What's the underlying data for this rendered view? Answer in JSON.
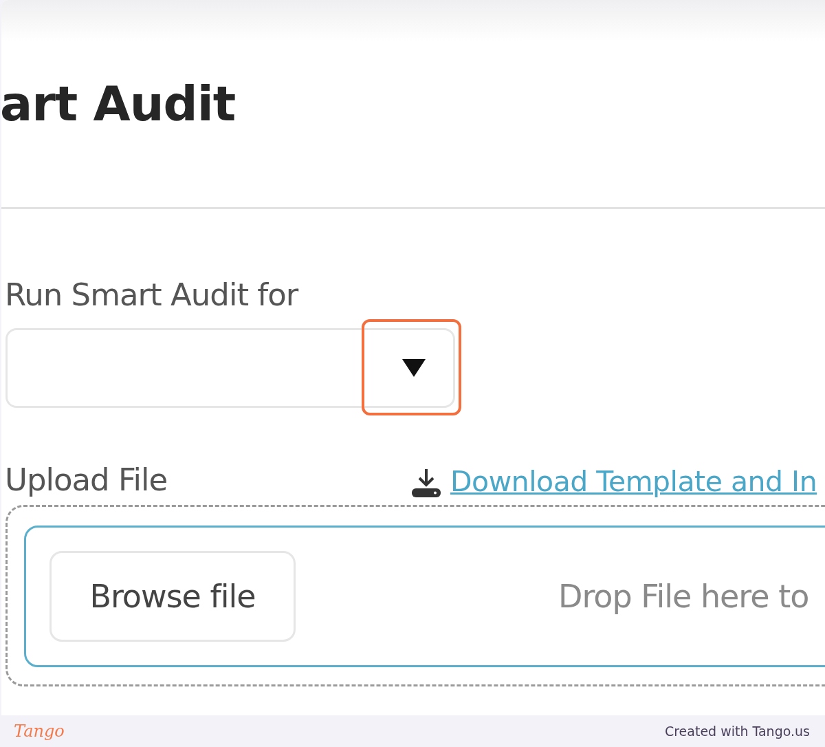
{
  "page": {
    "title": "art Audit"
  },
  "form": {
    "run_label": "Run Smart Audit for",
    "select": {
      "highlighted": true
    },
    "upload_label": "Upload File",
    "download_link": "Download Template and In",
    "browse_button": "Browse file",
    "drop_hint": "Drop File here to"
  },
  "footer": {
    "logo": "Tango",
    "credit": "Created with Tango.us"
  }
}
